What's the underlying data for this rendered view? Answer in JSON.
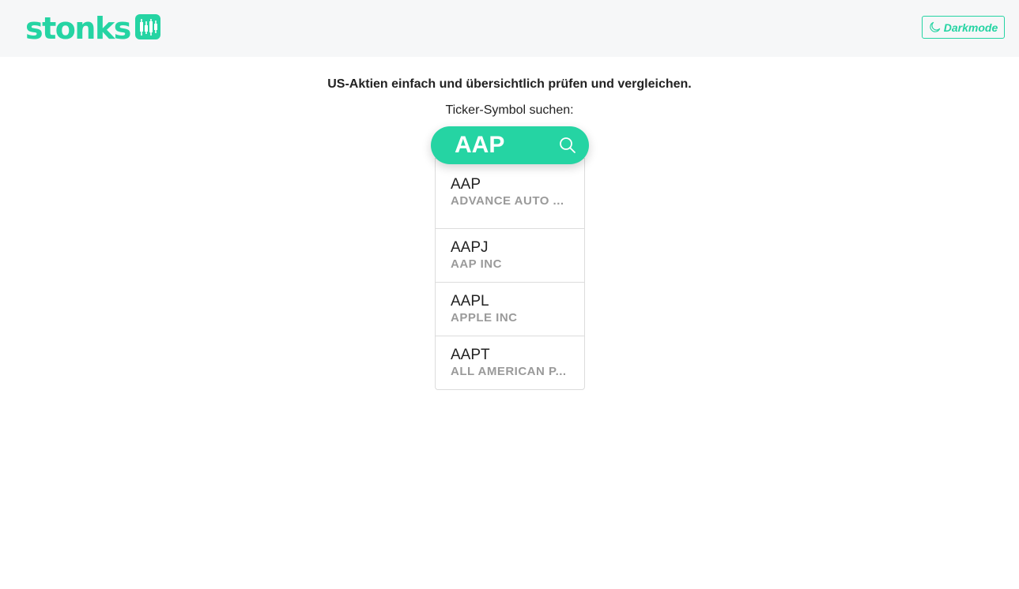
{
  "header": {
    "logo_text": "stonks",
    "darkmode_label": "Darkmode",
    "icons": {
      "logo_mark": "candlestick-chart-icon",
      "darkmode": "moon-icon"
    }
  },
  "main": {
    "tagline": "US-Aktien einfach und übersichtlich prüfen und vergleichen.",
    "search_label": "Ticker-Symbol suchen:",
    "search_value": "AAP",
    "search_icon": "search-icon",
    "suggestions": [
      {
        "ticker": "AAP",
        "name": "ADVANCE AUTO ..."
      },
      {
        "ticker": "AAPJ",
        "name": "AAP INC"
      },
      {
        "ticker": "AAPL",
        "name": "APPLE INC"
      },
      {
        "ticker": "AAPT",
        "name": "ALL AMERICAN P..."
      }
    ]
  },
  "colors": {
    "accent": "#25d4a3",
    "header_bg": "#f6f7f8",
    "muted_text": "#9a9a9a",
    "text": "#222222"
  }
}
